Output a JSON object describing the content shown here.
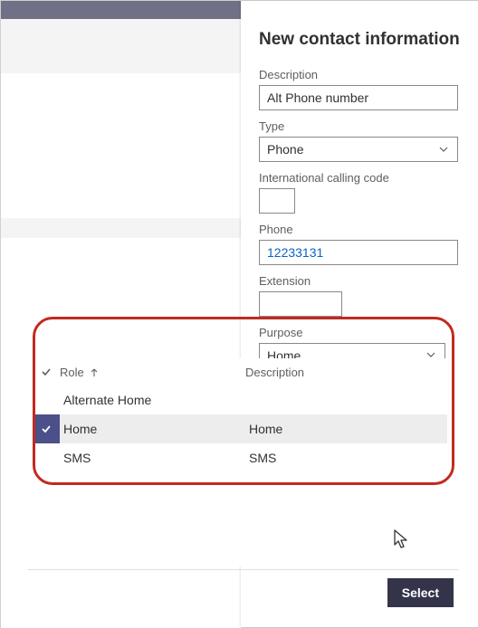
{
  "panel": {
    "title": "New contact information",
    "description_label": "Description",
    "description_value": "Alt Phone number",
    "type_label": "Type",
    "type_value": "Phone",
    "intl_label": "International calling code",
    "intl_value": "",
    "phone_label": "Phone",
    "phone_value": "12233131",
    "extension_label": "Extension",
    "extension_value": "",
    "purpose_label": "Purpose",
    "purpose_value": "Home"
  },
  "lookup": {
    "col_role": "Role",
    "col_description": "Description",
    "rows": [
      {
        "role": "Alternate Home",
        "description": "",
        "selected": false
      },
      {
        "role": "Home",
        "description": "Home",
        "selected": true
      },
      {
        "role": "SMS",
        "description": "SMS",
        "selected": false
      }
    ]
  },
  "buttons": {
    "select": "Select"
  }
}
